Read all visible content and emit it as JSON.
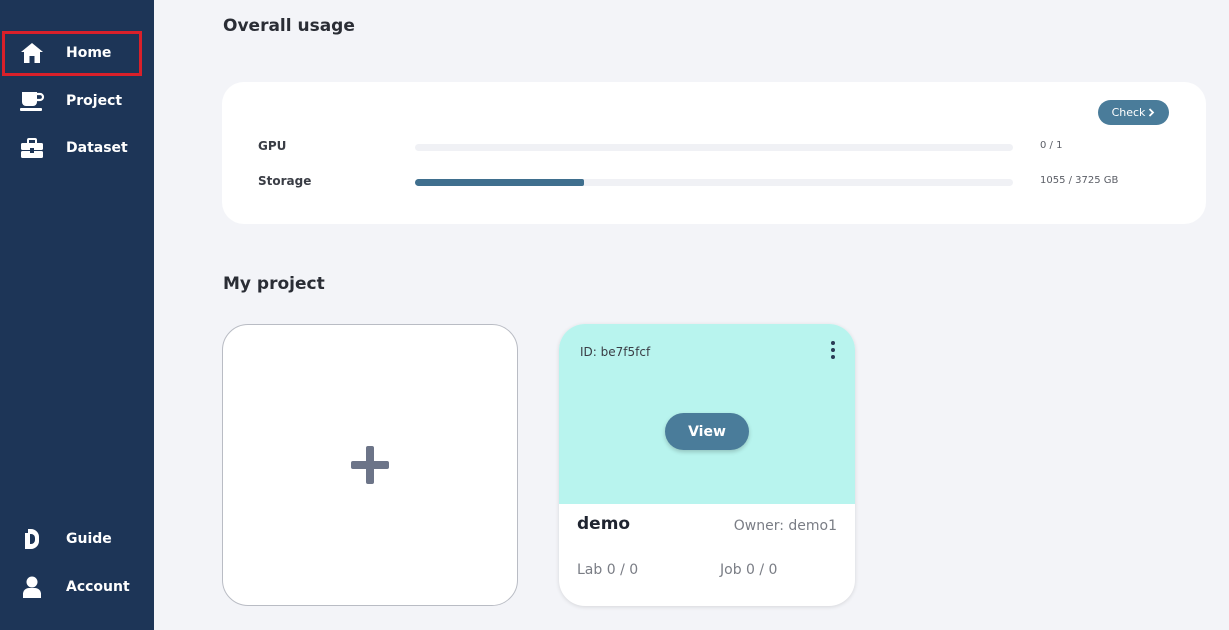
{
  "sidebar": {
    "items": [
      {
        "label": "Home",
        "icon": "home-icon"
      },
      {
        "label": "Project",
        "icon": "project-icon"
      },
      {
        "label": "Dataset",
        "icon": "dataset-icon"
      },
      {
        "label": "Guide",
        "icon": "guide-icon"
      },
      {
        "label": "Account",
        "icon": "account-icon"
      }
    ],
    "active": "Home"
  },
  "usage": {
    "title": "Overall usage",
    "check_label": "Check",
    "rows": [
      {
        "name": "GPU",
        "value_text": "0 / 1",
        "fraction": 0.0
      },
      {
        "name": "Storage",
        "value_text": "1055 / 3725 GB",
        "fraction": 0.283
      }
    ]
  },
  "projects": {
    "title": "My project",
    "items": [
      {
        "id_text": "ID: be7f5fcf",
        "view_label": "View",
        "name": "demo",
        "owner_text": "Owner: demo1",
        "lab_text": "Lab 0 / 0",
        "job_text": "Job 0 / 0"
      }
    ]
  },
  "colors": {
    "sidebar_bg": "#1d3557",
    "accent": "#4a7c9a",
    "card_top": "#b8f4ee",
    "active_outline": "#d9202a"
  }
}
